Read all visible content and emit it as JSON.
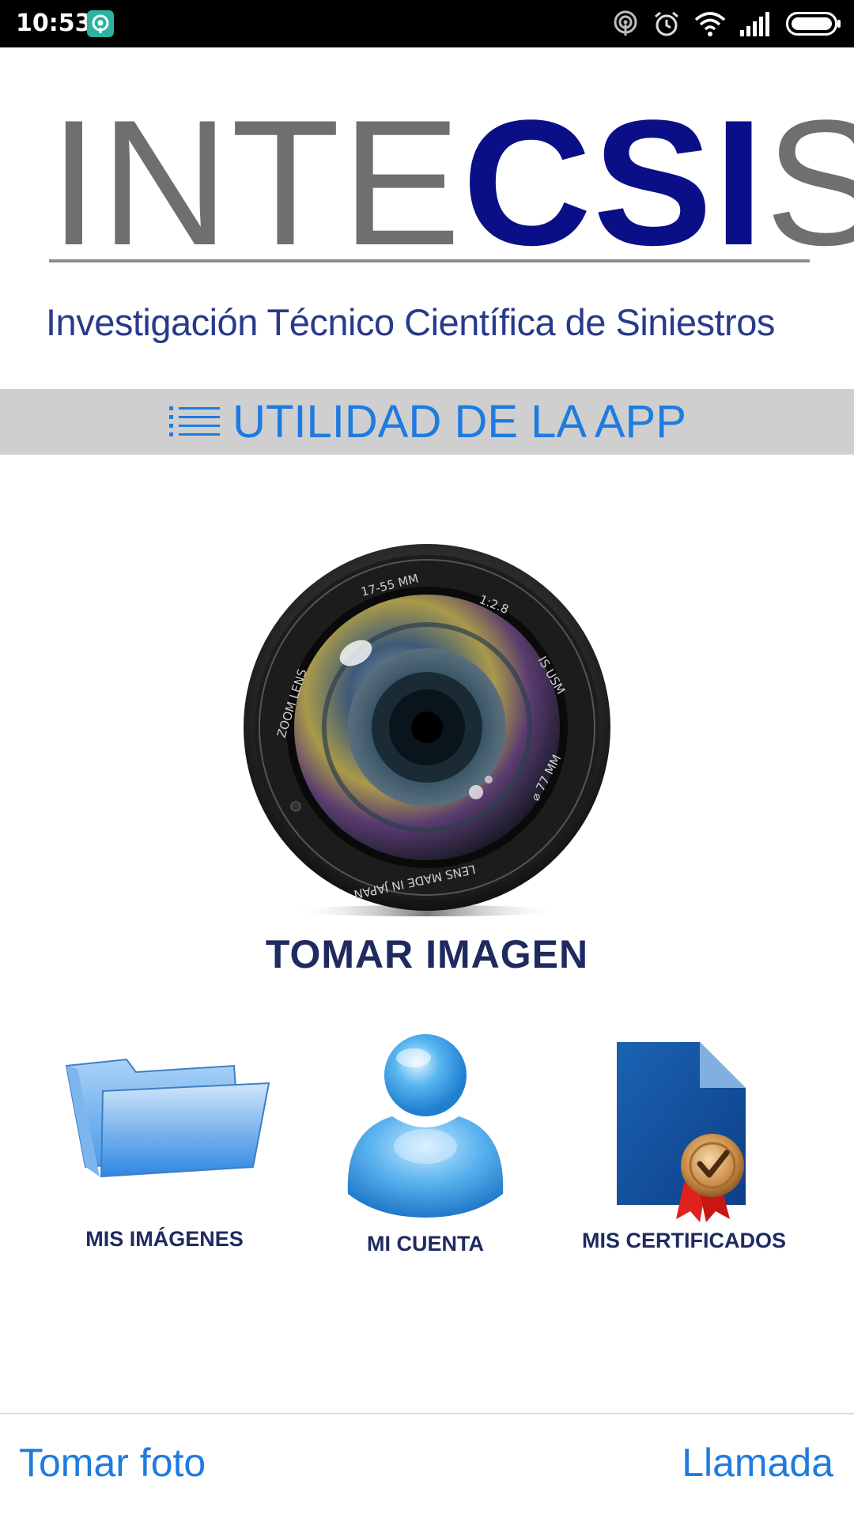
{
  "status_bar": {
    "time": "10:53",
    "notification_icon": "vpn-badge-icon",
    "icons": [
      "hotspot-icon",
      "alarm-icon",
      "wifi-icon",
      "signal-icon",
      "battery-icon"
    ],
    "notification_color": "#2bb3a0"
  },
  "header": {
    "logo_part_1": "INTE",
    "logo_part_2": "CSI",
    "logo_part_3": "S",
    "tagline": "Investigación Técnico Científica de Siniestros",
    "logo_gray": "#6f6f6f",
    "logo_blue": "#0a0f88"
  },
  "banner": {
    "label": "UTILIDAD DE LA APP",
    "icon": "list-icon",
    "background": "#cfcfcf",
    "accent": "#1e7be0"
  },
  "main_action": {
    "label": "TOMAR IMAGEN",
    "icon": "camera-lens-icon"
  },
  "tiles": [
    {
      "label": "MIS IMÁGENES",
      "icon": "folder-icon"
    },
    {
      "label": "MI CUENTA",
      "icon": "user-icon"
    },
    {
      "label": "MIS CERTIFICADOS",
      "icon": "certificate-icon"
    }
  ],
  "footer": {
    "left_label": "Tomar foto",
    "right_label": "Llamada"
  }
}
